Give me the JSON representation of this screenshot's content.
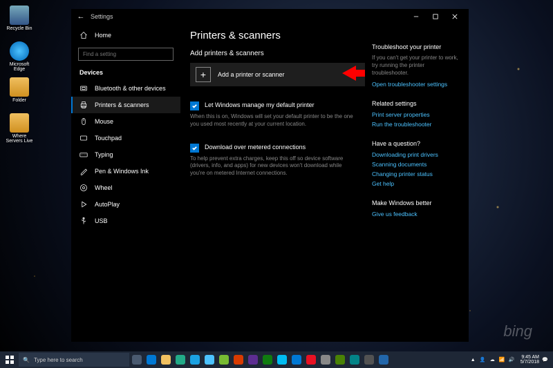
{
  "desktop": {
    "icons": [
      {
        "name": "Recycle Bin"
      },
      {
        "name": "Microsoft Edge"
      },
      {
        "name": "Folder"
      },
      {
        "name": "Where Servers Live"
      }
    ],
    "watermark": "bing"
  },
  "window": {
    "title": "Settings"
  },
  "sidebar": {
    "home": "Home",
    "search_placeholder": "Find a setting",
    "section": "Devices",
    "items": [
      {
        "label": "Bluetooth & other devices"
      },
      {
        "label": "Printers & scanners"
      },
      {
        "label": "Mouse"
      },
      {
        "label": "Touchpad"
      },
      {
        "label": "Typing"
      },
      {
        "label": "Pen & Windows Ink"
      },
      {
        "label": "Wheel"
      },
      {
        "label": "AutoPlay"
      },
      {
        "label": "USB"
      }
    ]
  },
  "main": {
    "heading": "Printers & scanners",
    "add_section": "Add printers & scanners",
    "add_button": "Add a printer or scanner",
    "opt1_label": "Let Windows manage my default printer",
    "opt1_desc": "When this is on, Windows will set your default printer to be the one you used most recently at your current location.",
    "opt2_label": "Download over metered connections",
    "opt2_desc": "To help prevent extra charges, keep this off so device software (drivers, info, and apps) for new devices won't download while you're on metered Internet connections."
  },
  "right": {
    "troubleshoot": {
      "title": "Troubleshoot your printer",
      "desc": "If you can't get your printer to work, try running the printer troubleshooter.",
      "link": "Open troubleshooter settings"
    },
    "related": {
      "title": "Related settings",
      "links": [
        "Print server properties",
        "Run the troubleshooter"
      ]
    },
    "question": {
      "title": "Have a question?",
      "links": [
        "Downloading print drivers",
        "Scanning documents",
        "Changing printer status",
        "Get help"
      ]
    },
    "better": {
      "title": "Make Windows better",
      "link": "Give us feedback"
    }
  },
  "taskbar": {
    "search_placeholder": "Type here to search",
    "time": "9:45 AM",
    "date": "5/7/2018"
  }
}
